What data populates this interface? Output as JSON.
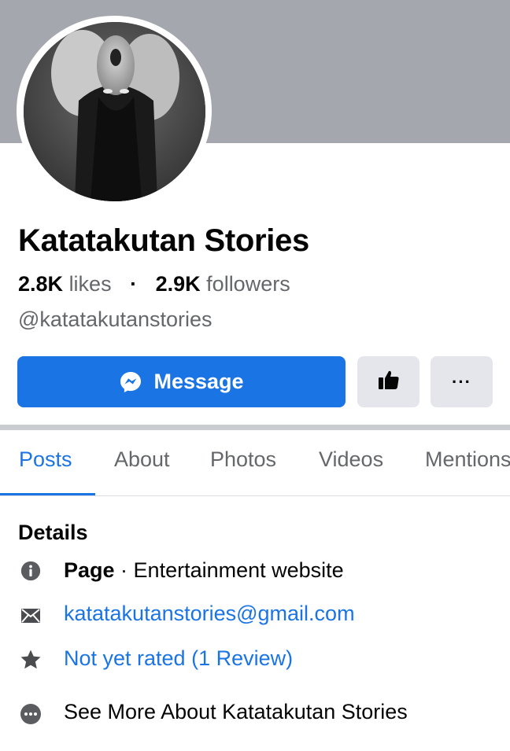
{
  "profile": {
    "name": "Katatakutan Stories",
    "likes_count": "2.8K",
    "likes_label": "likes",
    "separator": "·",
    "followers_count": "2.9K",
    "followers_label": "followers",
    "handle": "@katatakutanstories"
  },
  "actions": {
    "message_label": "Message",
    "more_label": "···"
  },
  "tabs": [
    {
      "label": "Posts",
      "active": true
    },
    {
      "label": "About",
      "active": false
    },
    {
      "label": "Photos",
      "active": false
    },
    {
      "label": "Videos",
      "active": false
    },
    {
      "label": "Mentions",
      "active": false
    }
  ],
  "details": {
    "title": "Details",
    "category_type": "Page",
    "category_sep": " · ",
    "category_value": "Entertainment website",
    "email": "katatakutanstories@gmail.com",
    "rating": "Not yet rated (1 Review)",
    "see_more": "See More About Katatakutan Stories"
  },
  "icons": {
    "info": "info-icon",
    "email": "envelope-icon",
    "rating": "star-icon",
    "more": "ellipsis-circle-icon",
    "messenger": "messenger-icon",
    "like": "thumbs-up-icon"
  },
  "colors": {
    "accent": "#1b74e4",
    "cover": "#a4a7ad",
    "button_gray": "#e4e6eb",
    "secondary_text": "#65676b"
  }
}
